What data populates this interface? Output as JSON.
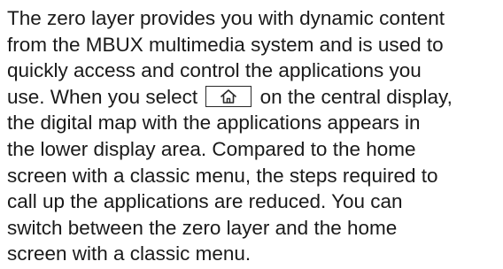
{
  "paragraph": {
    "lines": [
      "The zero layer provides you with dynamic content",
      "from the MBUX multimedia system and is used to",
      "quickly access and control the applications you",
      "use. When you select",
      "on the central display,",
      "the digital map with the applications appears in",
      "the lower display area. Compared to the home",
      "screen with a classic menu, the steps required to",
      "call up the applications are reduced. You can",
      "switch between the zero layer and the home",
      "screen with a classic menu."
    ],
    "inline_icon": "home-icon"
  }
}
